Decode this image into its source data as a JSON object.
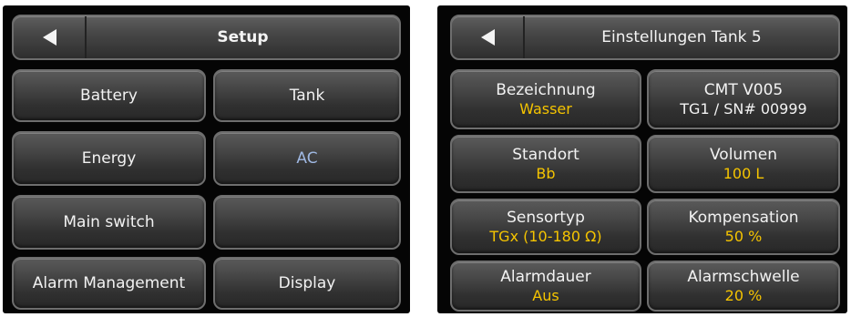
{
  "setup": {
    "title": "Setup",
    "buttons": [
      {
        "label": "Battery"
      },
      {
        "label": "Tank"
      },
      {
        "label": "Energy"
      },
      {
        "label": "AC"
      },
      {
        "label": "Main switch"
      },
      {
        "label": ""
      },
      {
        "label": "Alarm Management"
      },
      {
        "label": "Display"
      }
    ]
  },
  "tank": {
    "title": "Einstellungen Tank 5",
    "buttons": [
      {
        "label": "Bezeichnung",
        "value": "Wasser"
      },
      {
        "label": "CMT  V005",
        "value": "TG1 / SN# 00999"
      },
      {
        "label": "Standort",
        "value": "Bb"
      },
      {
        "label": "Volumen",
        "value": "100 L"
      },
      {
        "label": "Sensortyp",
        "value": "TGx (10-180 Ω)"
      },
      {
        "label": "Kompensation",
        "value": "50 %"
      },
      {
        "label": "Alarmdauer",
        "value": "Aus"
      },
      {
        "label": "Alarmschwelle",
        "value": "20 %"
      }
    ]
  },
  "colors": {
    "value_text": "#f5c400",
    "inactive_text": "#9fb8e2"
  },
  "icons": {
    "back": "back-arrow-icon"
  }
}
